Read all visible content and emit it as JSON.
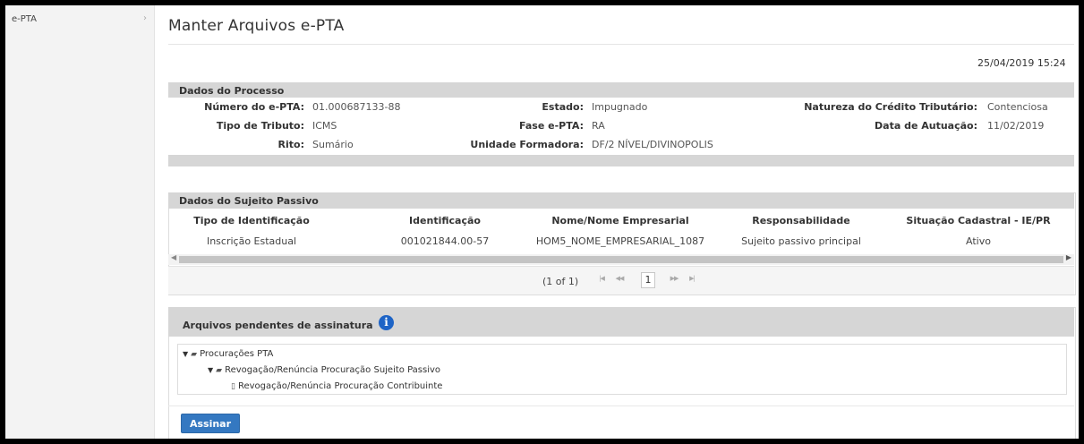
{
  "sidebar": {
    "item_label": "e-PTA",
    "chevron": "›"
  },
  "page_title": "Manter Arquivos e-PTA",
  "datetime": "25/04/2019 15:24",
  "processo": {
    "header": "Dados do Processo",
    "numero": {
      "label": "Número do e-PTA:",
      "value": "01.000687133-88"
    },
    "tipo_tributo": {
      "label": "Tipo de Tributo:",
      "value": "ICMS"
    },
    "rito": {
      "label": "Rito:",
      "value": "Sumário"
    },
    "estado": {
      "label": "Estado:",
      "value": "Impugnado"
    },
    "fase": {
      "label": "Fase e-PTA:",
      "value": "RA"
    },
    "unidade": {
      "label": "Unidade Formadora:",
      "value": "DF/2 NÍVEL/DIVINOPOLIS"
    },
    "natureza": {
      "label": "Natureza do Crédito Tributário:",
      "value": "Contenciosa"
    },
    "data_autuacao": {
      "label": "Data de Autuação:",
      "value": "11/02/2019"
    }
  },
  "sujeito": {
    "header": "Dados do Sujeito Passivo",
    "columns": [
      "Tipo de Identificação",
      "Identificação",
      "Nome/Nome Empresarial",
      "Responsabilidade",
      "Situação Cadastral - IE/PR"
    ],
    "rows": [
      [
        "Inscrição Estadual",
        "001021844.00-57",
        "HOM5_NOME_EMPRESARIAL_1087",
        "Sujeito passivo principal",
        "Ativo"
      ]
    ],
    "pager": {
      "report": "(1 of 1)",
      "current_page": "1",
      "first": "|◀",
      "prev": "◀◀",
      "next": "▶▶",
      "last": "▶|"
    }
  },
  "arquivos": {
    "header": "Arquivos pendentes de assinatura",
    "info_icon": "i",
    "tree": {
      "root": "Procurações PTA",
      "child": "Revogação/Renúncia Procuração Sujeito Passivo",
      "leaf": "Revogação/Renúncia Procuração Contribuinte"
    },
    "assinar_label": "Assinar"
  }
}
